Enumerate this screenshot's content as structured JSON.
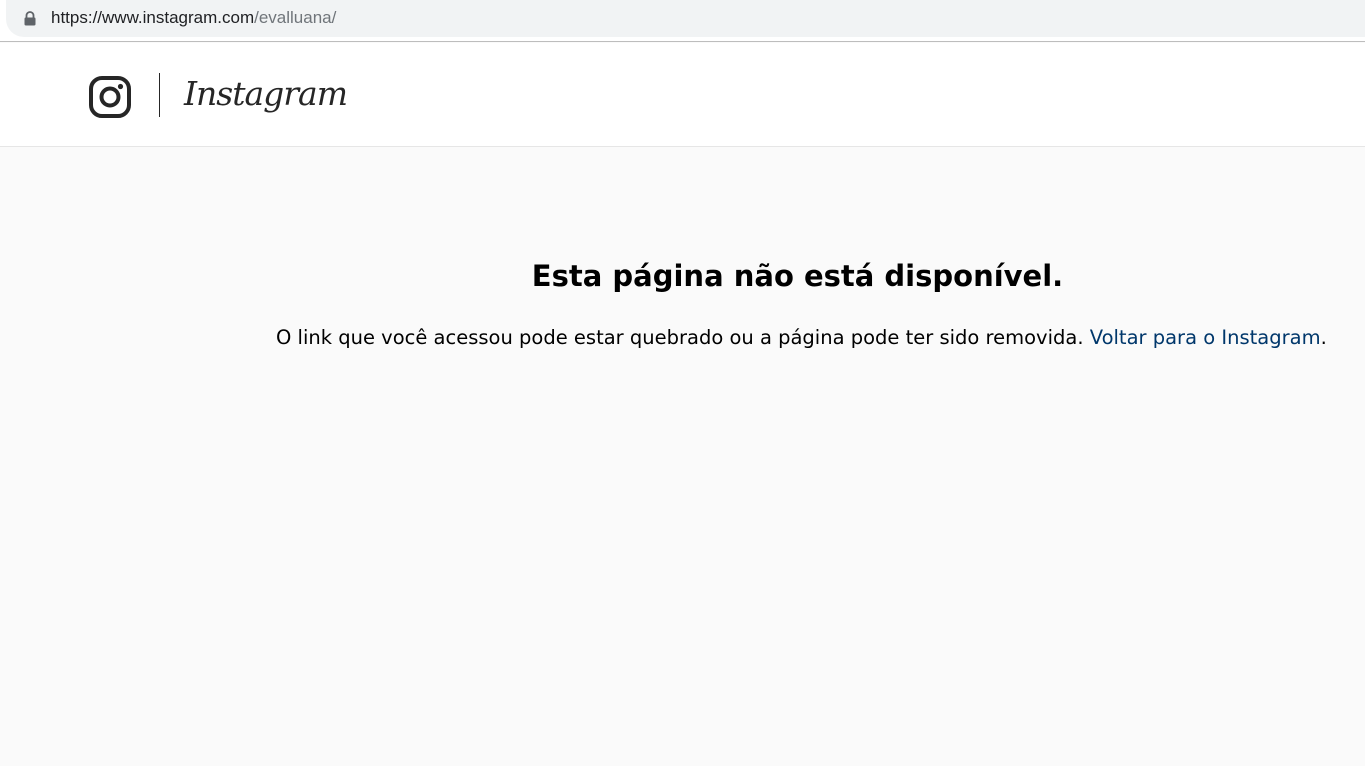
{
  "browser": {
    "url_host": "https://www.instagram.com",
    "url_path": "/evalluana/"
  },
  "header": {
    "logo_icon": "instagram-glyph-icon",
    "wordmark": "Instagram"
  },
  "error": {
    "title": "Esta página não está disponível.",
    "message": "O link que você acessou pode estar quebrado ou a página pode ter sido removida.",
    "link_label": "Voltar para o Instagram",
    "trailing": "."
  },
  "colors": {
    "link": "#00376b",
    "background": "#fafafa",
    "header_background": "#ffffff",
    "text": "#000000"
  }
}
